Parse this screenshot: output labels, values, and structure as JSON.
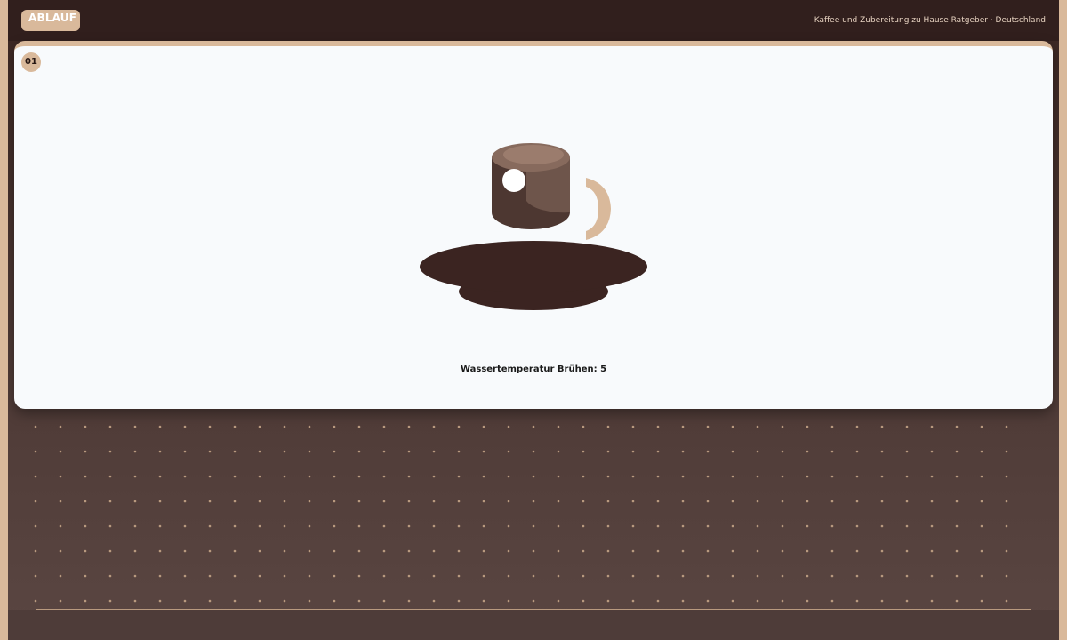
{
  "header": {
    "badge_label": "ABLAUF",
    "caption": "Kaffee und Zubereitung zu Hause Ratgeber · Deutschland"
  },
  "card": {
    "step_number": "01",
    "temperature_label": "Wassertemperatur Brühen: 5"
  },
  "colors": {
    "accent": "#d9b99b",
    "topbar": "#311f1d",
    "background_dark": "#4d3935",
    "card": "#f8fafc",
    "cup_body": "#6d5349",
    "cup_top": "#987667",
    "saucer": "#3b2421",
    "handle": "#d9b99b",
    "text_dark": "#1a1a1a"
  },
  "icons": {
    "illustration": "coffee-cup-on-saucer-icon",
    "decoration": "dot-grid-pattern"
  }
}
